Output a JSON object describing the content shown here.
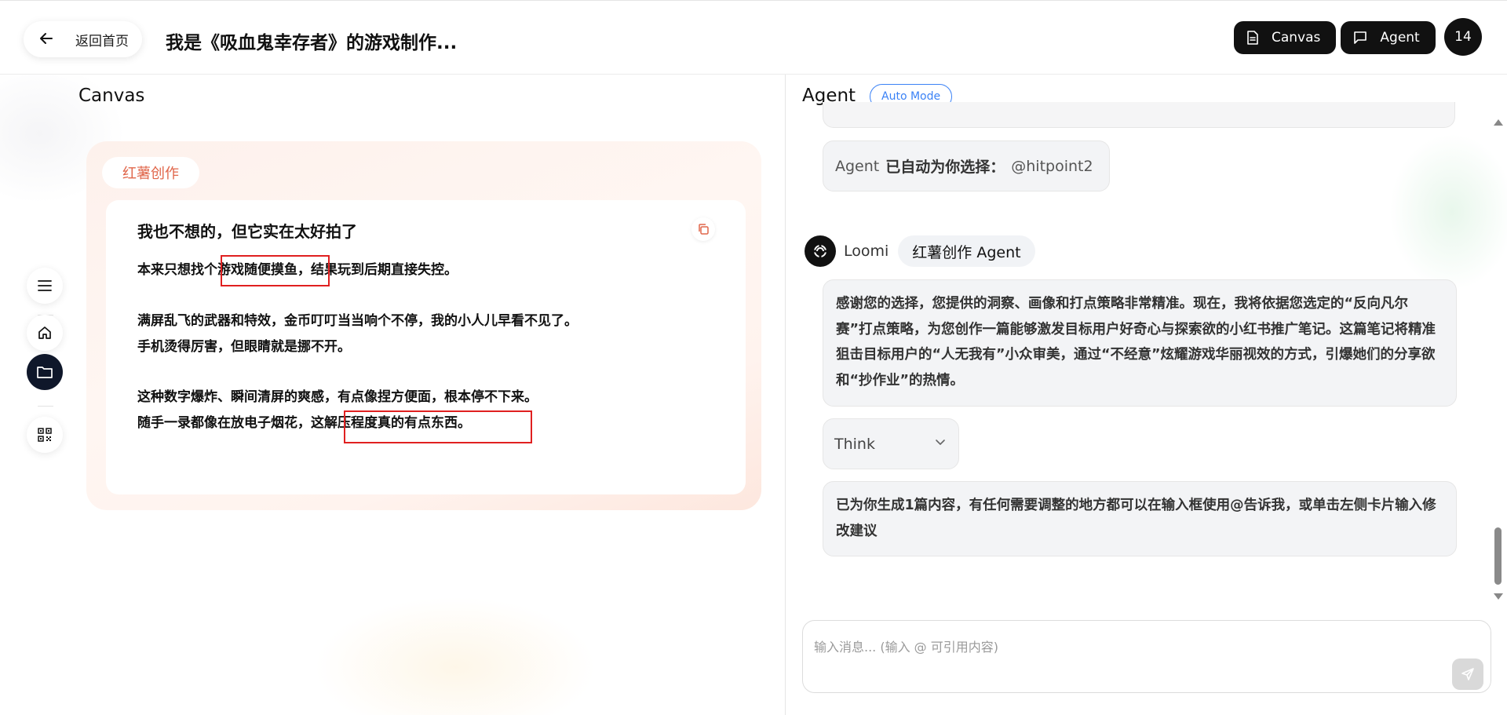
{
  "header": {
    "back_label": "返回首页",
    "title": "我是《吸血鬼幸存者》的游戏制作...",
    "canvas_toggle": "Canvas",
    "agent_toggle": "Agent",
    "user_badge": "14"
  },
  "canvas": {
    "label": "Canvas",
    "card": {
      "tag": "红薯创作",
      "heading": "我也不想的，但它实在太好拍了",
      "lines": [
        "本来只想找个游戏随便摸鱼，结果玩到后期直接失控。",
        "满屏乱飞的武器和特效，金币叮叮当当响个不停，我的小人儿早看不见了。",
        "手机烫得厉害，但眼睛就是挪不开。",
        "这种数字爆炸、瞬间清屏的爽感，有点像捏方便面，根本停不下来。",
        "随手一录都像在放电子烟花，这解压程度真的有点东西。"
      ]
    }
  },
  "agent": {
    "label": "Agent",
    "mode_badge": "Auto Mode",
    "selection": {
      "prefix": "Agent",
      "bold": "已自动为你选择：",
      "value": "@hitpoint2"
    },
    "sender": {
      "name": "Loomi",
      "agent_chip": "红薯创作 Agent"
    },
    "message_1": "感谢您的选择，您提供的洞察、画像和打点策略非常精准。现在，我将依据您选定的“反向凡尔赛”打点策略，为您创作一篇能够激发目标用户好奇心与探索欲的小红书推广笔记。这篇笔记将精准狙击目标用户的“人无我有”小众审美，通过“不经意”炫耀游戏华丽视效的方式，引爆她们的分享欲和“抄作业”的热情。",
    "think_label": "Think",
    "message_2": "已为你生成1篇内容，有任何需要调整的地方都可以在输入框使用@告诉我，或单击左侧卡片输入修改建议"
  },
  "input": {
    "placeholder": "输入消息... (输入 @ 可引用内容)",
    "value": ""
  },
  "rail_icons": [
    "menu-icon",
    "home-icon",
    "folder-icon",
    "qr-code-icon"
  ],
  "colors": {
    "accent_dark": "#111111",
    "tag_orange": "#e0664a",
    "mode_blue": "#3b82f6",
    "highlight_red": "#e02020"
  }
}
